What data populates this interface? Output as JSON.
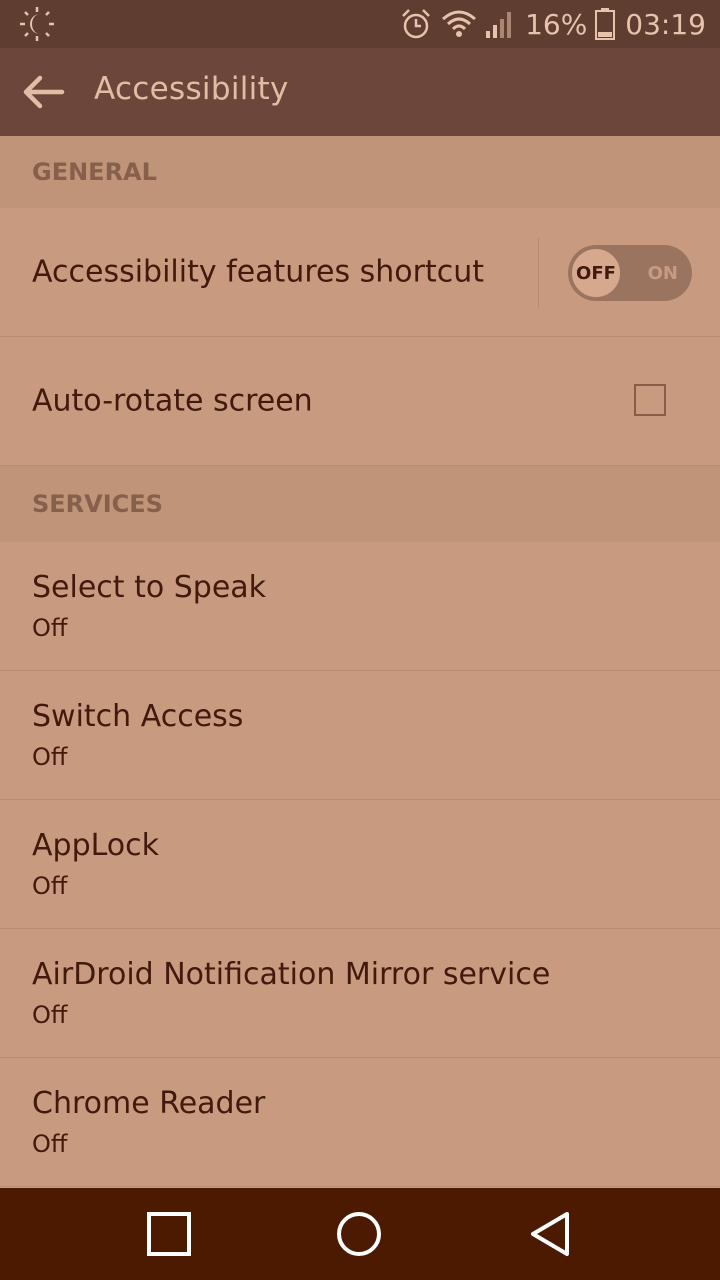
{
  "status_bar": {
    "left_icon": "night-mode-icon",
    "alarm_icon": "alarm-clock-icon",
    "wifi_icon": "wifi-icon",
    "signal_icon": "cellular-signal-icon",
    "battery_percent": "16%",
    "battery_icon": "battery-icon",
    "time": "03:19"
  },
  "app_bar": {
    "back_icon": "arrow-back-icon",
    "title": "Accessibility"
  },
  "sections": {
    "general": {
      "header": "GENERAL",
      "shortcut": {
        "title": "Accessibility features shortcut",
        "toggle_off_label": "OFF",
        "toggle_on_label": "ON",
        "state": "off"
      },
      "auto_rotate": {
        "title": "Auto-rotate screen",
        "checked": false
      }
    },
    "services": {
      "header": "SERVICES",
      "items": [
        {
          "title": "Select to Speak",
          "status": "Off"
        },
        {
          "title": "Switch Access",
          "status": "Off"
        },
        {
          "title": "AppLock",
          "status": "Off"
        },
        {
          "title": "AirDroid Notification Mirror service",
          "status": "Off"
        },
        {
          "title": "Chrome Reader",
          "status": "Off"
        }
      ]
    }
  },
  "nav_bar": {
    "recents_icon": "recents-square-icon",
    "home_icon": "home-circle-icon",
    "back_icon": "back-triangle-icon"
  },
  "colors": {
    "status_bar": "#5f3d31",
    "app_bar": "#6c463b",
    "background": "#c89b80",
    "section_header": "#c09479",
    "nav_bar": "#4c1a00",
    "text_primary": "#41190d"
  }
}
